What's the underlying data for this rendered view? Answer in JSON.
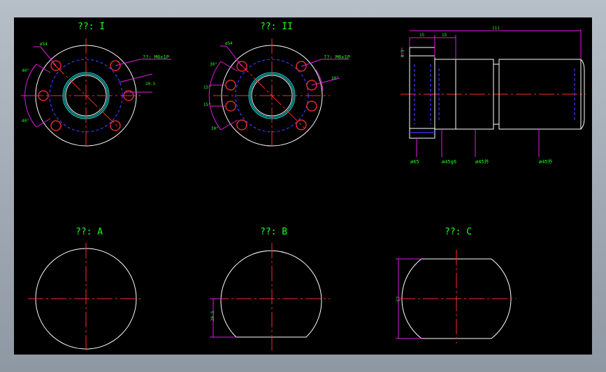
{
  "colors": {
    "background": "#000000",
    "outline": "#ffffff",
    "center_line": "#ff2a2a",
    "hidden_line": "#3a3aff",
    "dimension": "#e619e6",
    "text": "#19ff19",
    "bore": "#19e6e6"
  },
  "views": [
    {
      "title": "??: I",
      "dims": {
        "bolt_dia": "ø54",
        "thread": "??: M6x1P",
        "angle_top": "40°",
        "angle_bottom": "40°",
        "offset": "20.5"
      }
    },
    {
      "title": "??: II",
      "dims": {
        "bolt_dia": "ø54",
        "thread": "??: M6x1P",
        "angle_a": "30°",
        "angle_b": "15°",
        "angle_c": "15°",
        "angle_d": "30°",
        "angle_right": "30°"
      }
    },
    {
      "title": "??: A"
    },
    {
      "title": "??: B",
      "dims": {
        "flat": "26.5"
      }
    },
    {
      "title": "??: C",
      "dims": {
        "flat": "57"
      }
    }
  ],
  "side": {
    "dims": {
      "w1": "15",
      "w2": "15",
      "length": "111",
      "step": "8.5",
      "d1": "ø65",
      "d2": "ø45g6",
      "d3": "ø45外",
      "d4": "ø45外"
    }
  }
}
